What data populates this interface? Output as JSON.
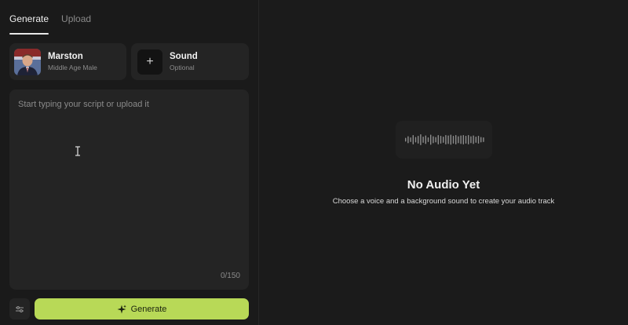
{
  "tabs": [
    {
      "label": "Generate",
      "active": true
    },
    {
      "label": "Upload",
      "active": false
    }
  ],
  "voice": {
    "name": "Marston",
    "description": "Middle Age Male"
  },
  "sound": {
    "title": "Sound",
    "subtitle": "Optional",
    "add_icon": "+"
  },
  "script": {
    "placeholder": "Start typing your script or upload it",
    "value": "",
    "char_count": "0/150"
  },
  "actions": {
    "settings_icon": "sliders-icon",
    "generate_label": "Generate",
    "generate_icon": "sparkle-icon"
  },
  "empty_state": {
    "title": "No Audio Yet",
    "description": "Choose a voice and a background sound to create your audio track"
  },
  "colors": {
    "accent": "#b8d957",
    "background": "#1b1b1b",
    "card": "#242424"
  }
}
